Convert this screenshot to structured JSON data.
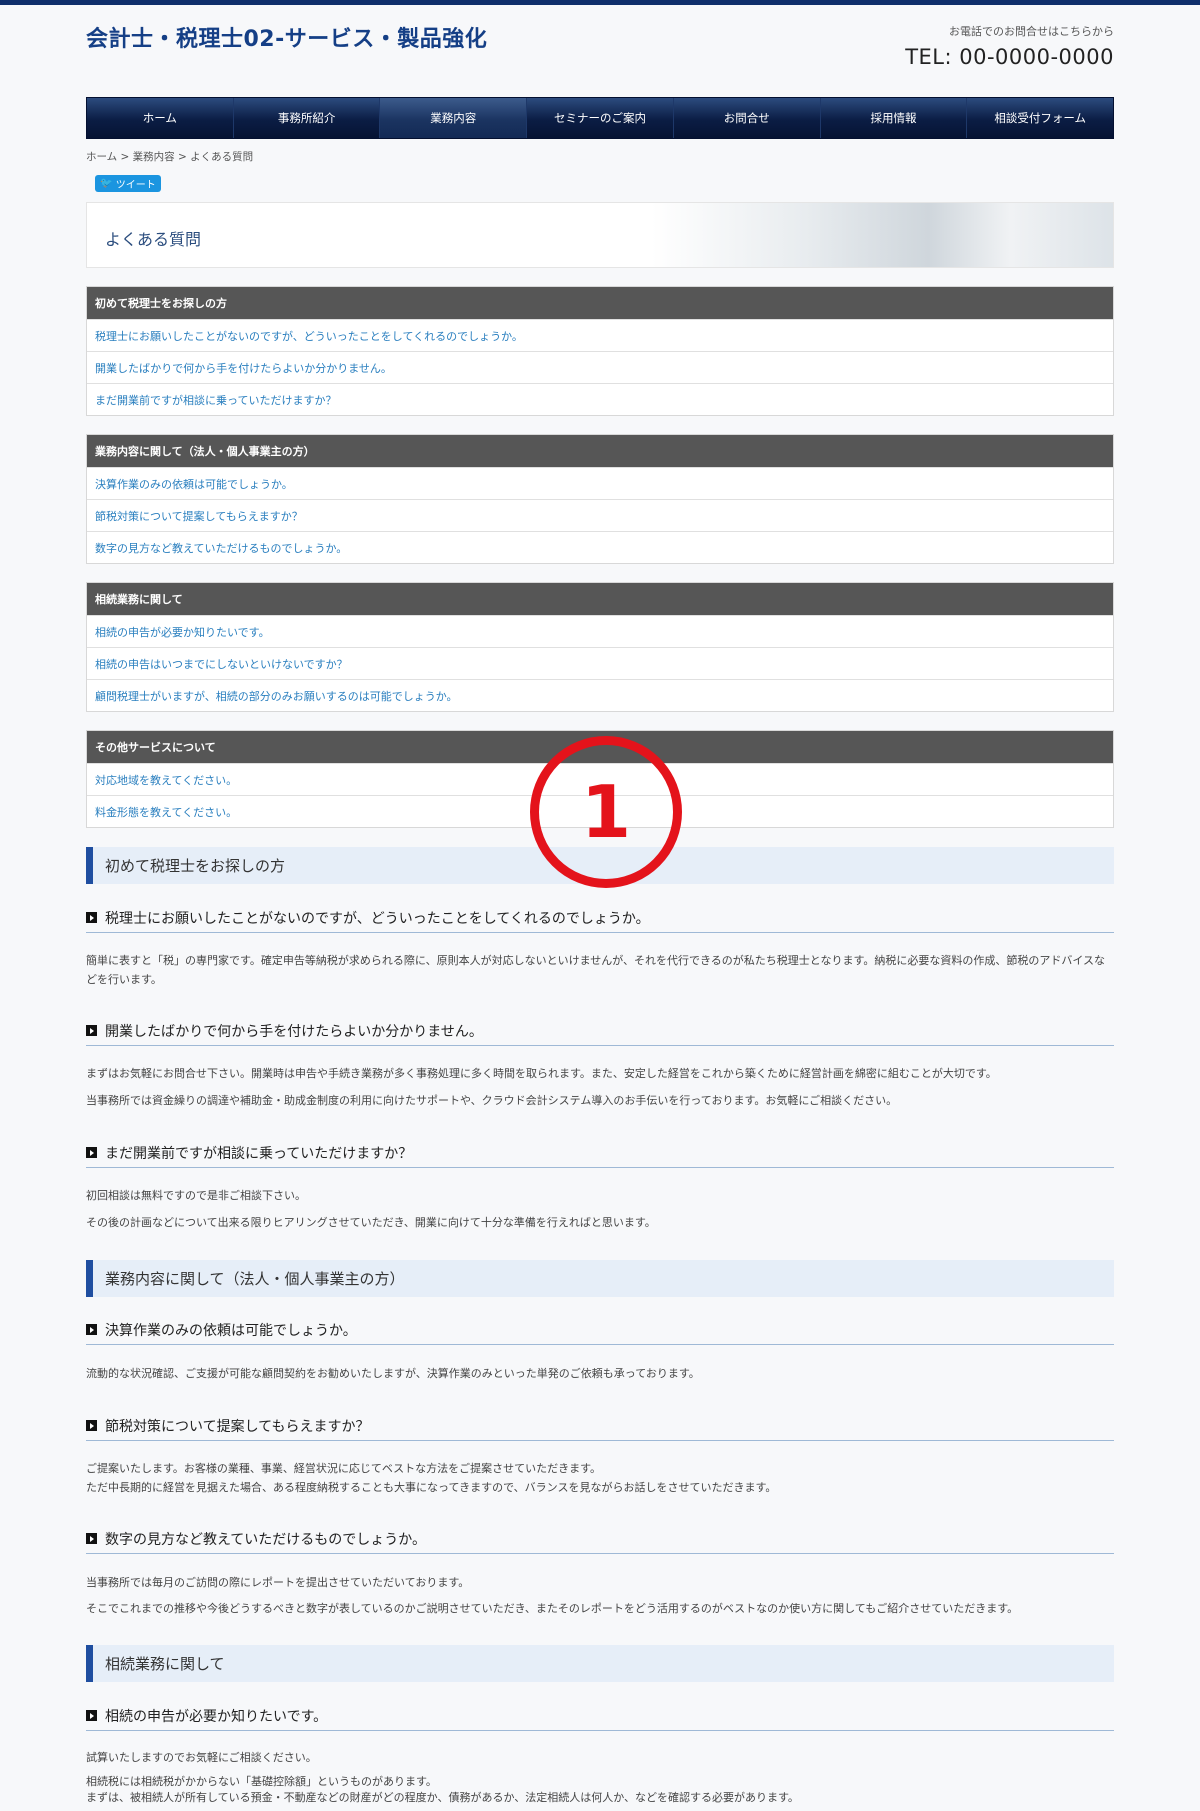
{
  "header": {
    "site_title": "会計士・税理士02-サービス・製品強化",
    "contact_note": "お電話でのお問合せはこちらから",
    "tel": "TEL: 00-0000-0000"
  },
  "nav": [
    "ホーム",
    "事務所紹介",
    "業務内容",
    "セミナーのご案内",
    "お問合せ",
    "採用情報",
    "相談受付フォーム"
  ],
  "breadcrumb": {
    "home": "ホーム",
    "sep1": " > ",
    "services": "業務内容",
    "sep2": " > ",
    "current": "よくある質問"
  },
  "tweet_label": "ツイート",
  "page_title": "よくある質問",
  "marker_number": "1",
  "faq_index": [
    {
      "title": "初めて税理士をお探しの方",
      "items": [
        "税理士にお願いしたことがないのですが、どういったことをしてくれるのでしょうか。",
        "開業したばかりで何から手を付けたらよいか分かりません。",
        "まだ開業前ですが相談に乗っていただけますか？"
      ]
    },
    {
      "title": "業務内容に関して（法人・個人事業主の方）",
      "items": [
        "決算作業のみの依頼は可能でしょうか。",
        "節税対策について提案してもらえますか？",
        "数字の見方など教えていただけるものでしょうか。"
      ]
    },
    {
      "title": "相続業務に関して",
      "items": [
        "相続の申告が必要か知りたいです。",
        "相続の申告はいつまでにしないといけないですか？",
        "顧問税理士がいますが、相続の部分のみお願いするのは可能でしょうか。"
      ]
    },
    {
      "title": "その他サービスについて",
      "items": [
        "対応地域を教えてください。",
        "料金形態を教えてください。"
      ]
    }
  ],
  "sections": [
    {
      "title": "初めて税理士をお探しの方"
    },
    {
      "title": "業務内容に関して（法人・個人事業主の方）"
    },
    {
      "title": "相続業務に関して"
    }
  ],
  "questions": [
    {
      "q": "税理士にお願いしたことがないのですが、どういったことをしてくれるのでしょうか。",
      "a": [
        "簡単に表すと「税」の専門家です。確定申告等納税が求められる際に、原則本人が対応しないといけませんが、それを代行できるのが私たち税理士となります。納税に必要な資料の作成、節税のアドバイスなどを行います。"
      ]
    },
    {
      "q": "開業したばかりで何から手を付けたらよいか分かりません。",
      "a": [
        "まずはお気軽にお問合せ下さい。開業時は申告や手続き業務が多く事務処理に多く時間を取られます。また、安定した経営をこれから築くために経営計画を綿密に組むことが大切です。",
        "当事務所では資金繰りの調達や補助金・助成金制度の利用に向けたサポートや、クラウド会計システム導入のお手伝いを行っております。お気軽にご相談ください。"
      ]
    },
    {
      "q": "まだ開業前ですが相談に乗っていただけますか？",
      "a": [
        "初回相談は無料ですので是非ご相談下さい。",
        "その後の計画などについて出来る限りヒアリングさせていただき、開業に向けて十分な準備を行えればと思います。"
      ]
    },
    {
      "q": "決算作業のみの依頼は可能でしょうか。",
      "a": [
        "流動的な状況確認、ご支援が可能な顧問契約をお勧めいたしますが、決算作業のみといった単発のご依頼も承っております。"
      ]
    },
    {
      "q": "節税対策について提案してもらえますか？",
      "a": [
        "ご提案いたします。お客様の業種、事業、経営状況に応じてベストな方法をご提案させていただきます。",
        "ただ中長期的に経営を見据えた場合、ある程度納税することも大事になってきますので、バランスを見ながらお話しをさせていただきます。"
      ]
    },
    {
      "q": "数字の見方など教えていただけるものでしょうか。",
      "a": [
        "当事務所では毎月のご訪問の際にレポートを提出させていただいております。",
        "そこでこれまでの推移や今後どうするべきと数字が表しているのかご説明させていただき、またそのレポートをどう活用するのがベストなのか使い方に関してもご紹介させていただきます。"
      ]
    },
    {
      "q": "相続の申告が必要か知りたいです。",
      "a": [
        "試算いたしますのでお気軽にご相談ください。",
        "相続税には相続税がかからない「基礎控除額」というものがあります。",
        "まずは、被相続人が所有している預金・不動産などの財産がどの程度か、債務があるか、法定相続人は何人か、などを確認する必要があります。"
      ]
    }
  ]
}
